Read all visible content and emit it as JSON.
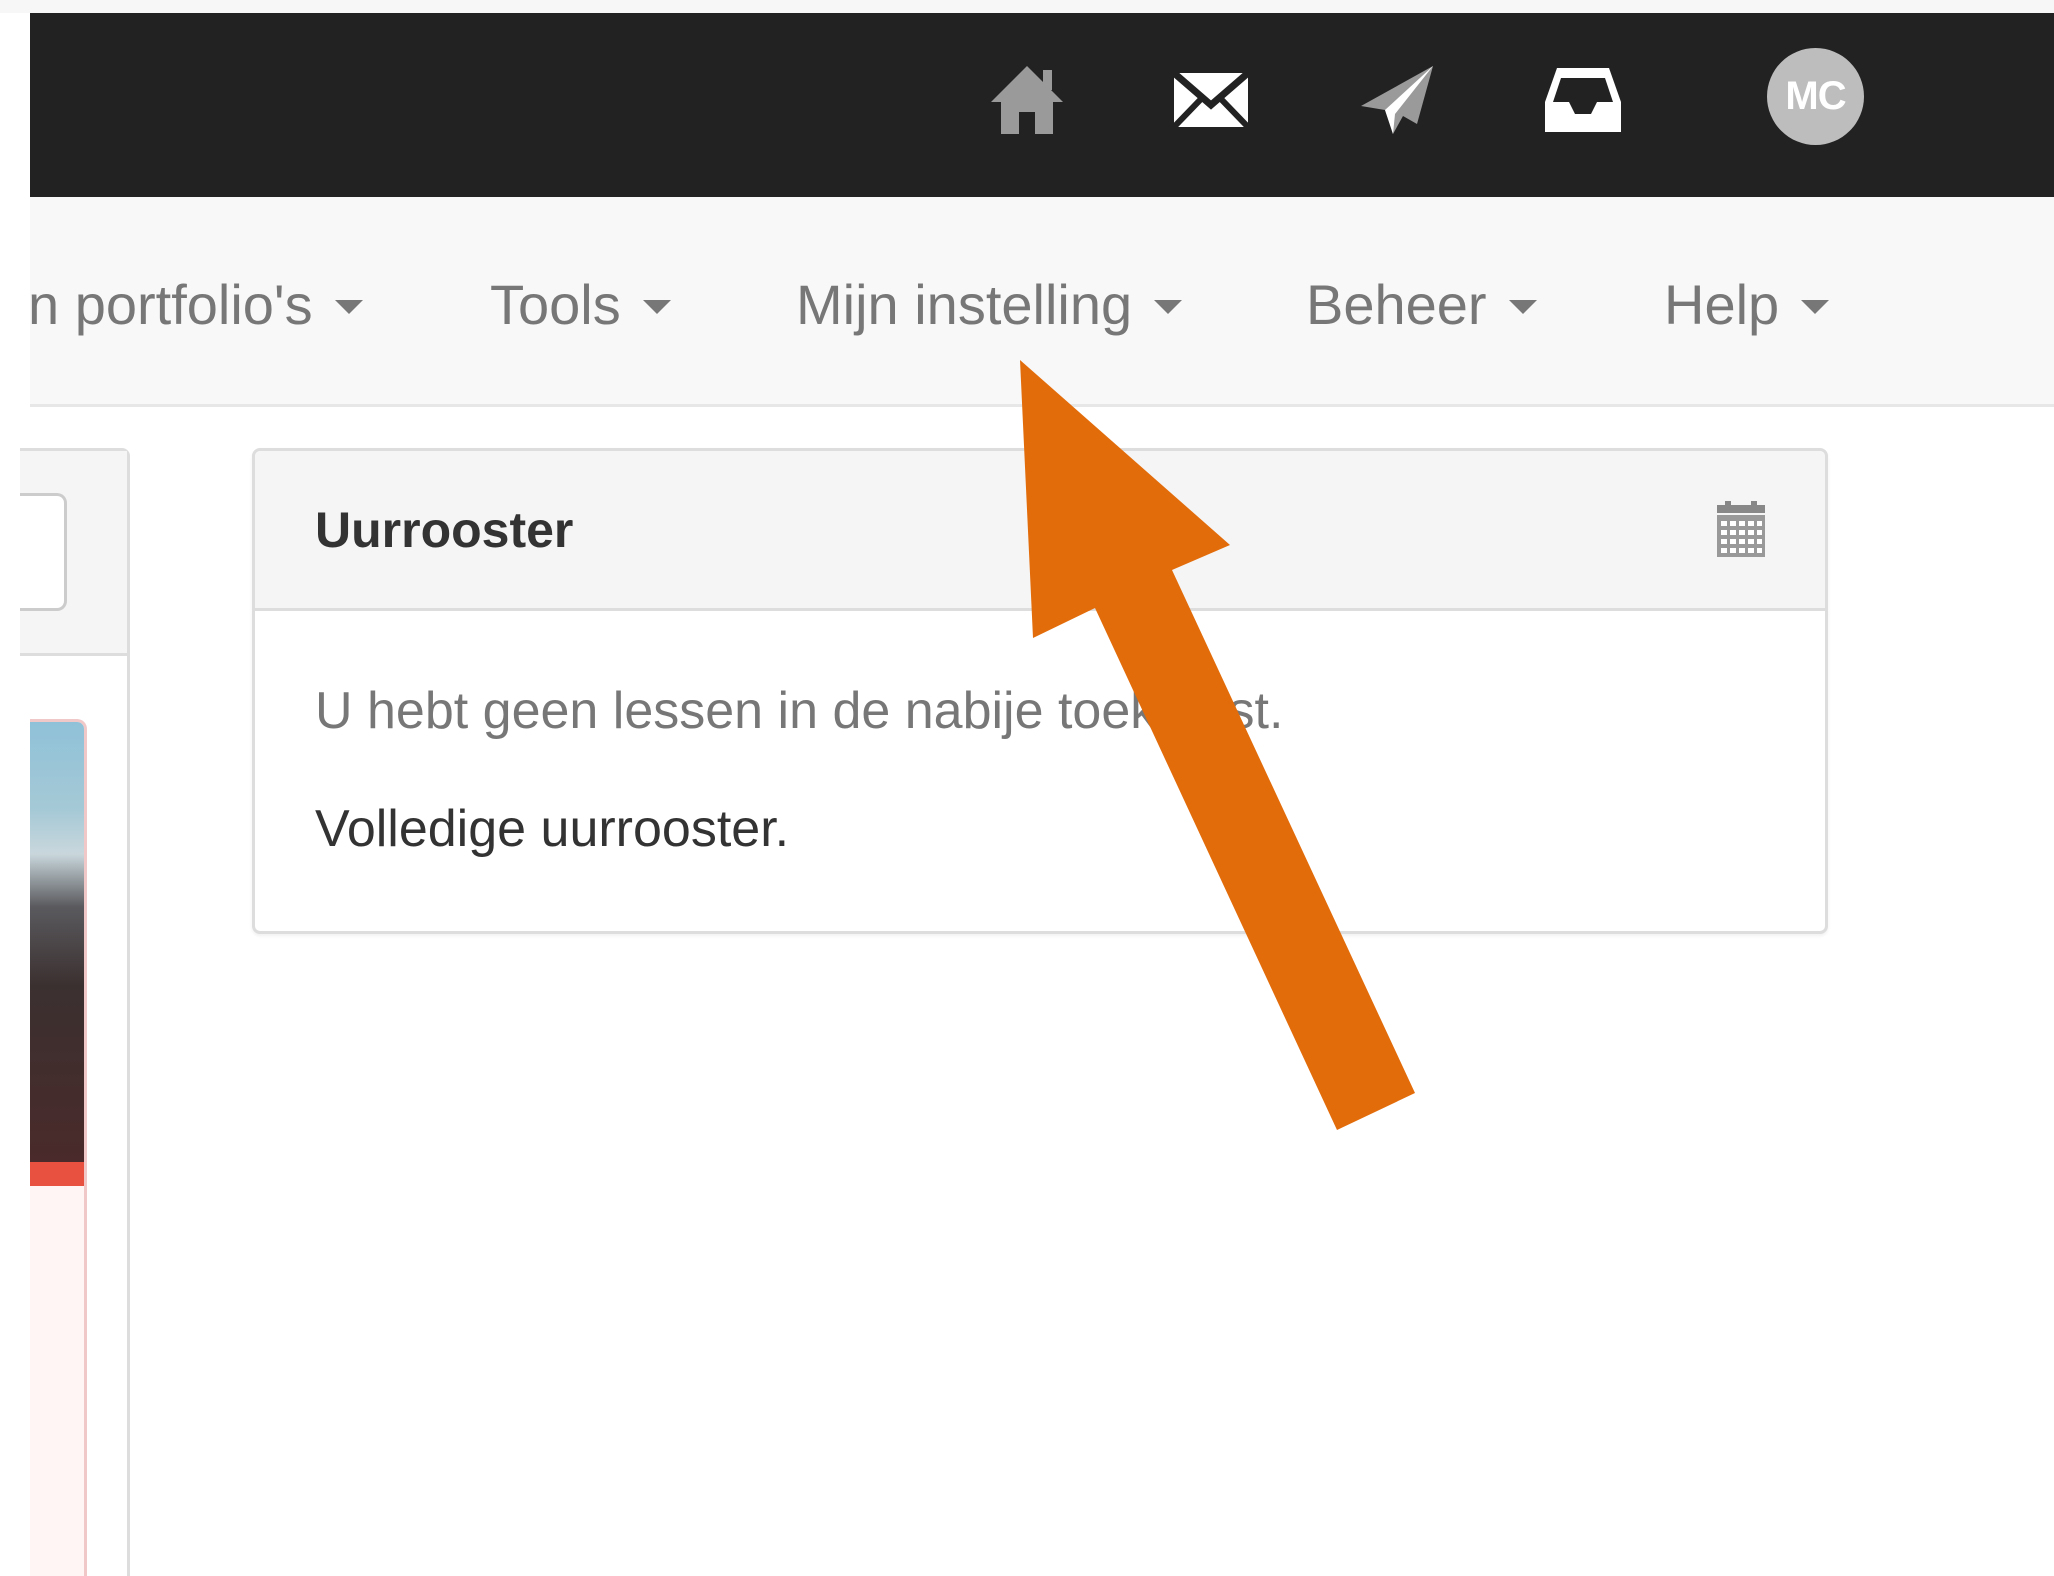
{
  "topbar": {
    "icons": [
      "home-icon",
      "envelope-icon",
      "paper-plane-icon",
      "inbox-icon"
    ],
    "avatar_initials": "MC"
  },
  "nav": {
    "items": [
      {
        "label": "n portfolio's"
      },
      {
        "label": "Tools"
      },
      {
        "label": "Mijn instelling"
      },
      {
        "label": "Beheer"
      },
      {
        "label": "Help"
      }
    ]
  },
  "schedule": {
    "title": "Uurrooster",
    "empty_message": "U hebt geen lessen in de nabije toekomst.",
    "full_link": "Volledige uurrooster."
  },
  "annotation": {
    "arrow_color": "#e36c0a"
  }
}
